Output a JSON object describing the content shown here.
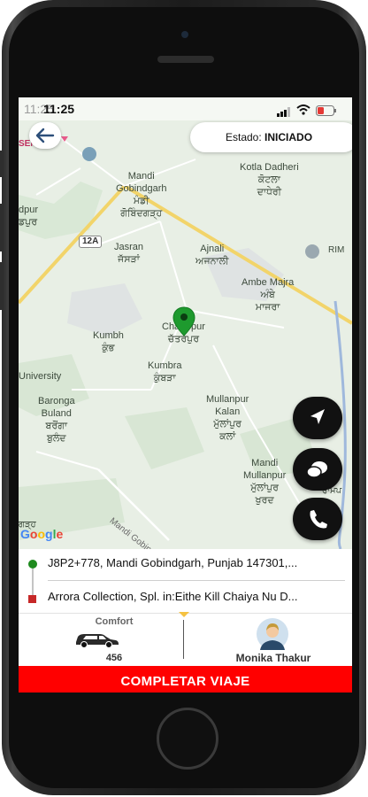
{
  "status_bar": {
    "time": "11:25"
  },
  "header": {
    "status_label": "Estado:",
    "status_value": "INICIADO"
  },
  "map": {
    "places": {
      "mandi_en": "Mandi",
      "mandi_en2": "Gobindgarh",
      "mandi_pa": "ਮੰਡੀ",
      "mandi_pa2": "ਗੋਬਿੰਦਗੜ੍ਹ",
      "kotla_en": "Kotla Dadheri",
      "kotla_pa": "ਕੋਟਲਾ",
      "kotla_pa2": "ਦਾਧੇਰੀ",
      "dpur_en": "dpur",
      "dpur_pa": "ਡਪੁਰ",
      "jasran_en": "Jasran",
      "jasran_pa": "ਜੱਸੜਾਂ",
      "ajnali_en": "Ajnali",
      "ajnali_pa": "ਅਜਨਾਲੀ",
      "ambe_en": "Ambe Majra",
      "ambe_pa": "ਅੰਬੇ",
      "ambe_pa2": "ਮਾਜਰਾ",
      "chatarpur_en": "Chatarpur",
      "chatarpur_pa": "ਚੱਤਰਪੁਰ",
      "kumbh_en": "Kumbh",
      "kumbh_pa": "ਕੁੰਭ",
      "kumbra_en": "Kumbra",
      "kumbra_pa": "ਕੁੰਬੜਾ",
      "university": "University",
      "baronga_en": "Baronga",
      "baronga_en2": "Buland",
      "baronga_pa": "ਬਰੋਂਗਾ",
      "baronga_pa2": "ਬੁਲੰਦ",
      "mullanpur_kalan_en": "Mullanpur",
      "mullanpur_kalan_en2": "Kalan",
      "mullanpur_kalan_pa": "ਮੁੱਲਾਂਪੁਰ",
      "mullanpur_kalan_pa2": "ਕਲਾਂ",
      "mandi_mullanpur_en": "Mandi",
      "mandi_mullanpur_en2": "Mullanpur",
      "mandi_mullanpur_pa": "ਮੁੱਲਾਂਪੁਰ",
      "mandi_mullanpur_pa2": "ਖੁਰਦ",
      "rim": "RIM",
      "ramp": "ਰਾਮਪ",
      "road_label": "Mandi Gobindgarh",
      "route_badge": "12A",
      "garh_pa": "ਗੜ੍ਹ",
      "google": "Google",
      "sen": "SEN"
    }
  },
  "trip": {
    "pickup": "J8P2+778, Mandi Gobindgarh, Punjab 147301,...",
    "dropoff": "Arrora Collection, Spl. in:Eithe Kill Chaiya Nu D..."
  },
  "vehicle": {
    "category": "Comfort",
    "number": "456"
  },
  "driver": {
    "name": "Monika Thakur"
  },
  "actions": {
    "complete_label": "COMPLETAR VIAJE"
  },
  "colors": {
    "accent_red": "#ff0000",
    "pickup_green": "#1e8a1e",
    "dropoff_red": "#c62828",
    "map_road": "#f2d46a"
  }
}
